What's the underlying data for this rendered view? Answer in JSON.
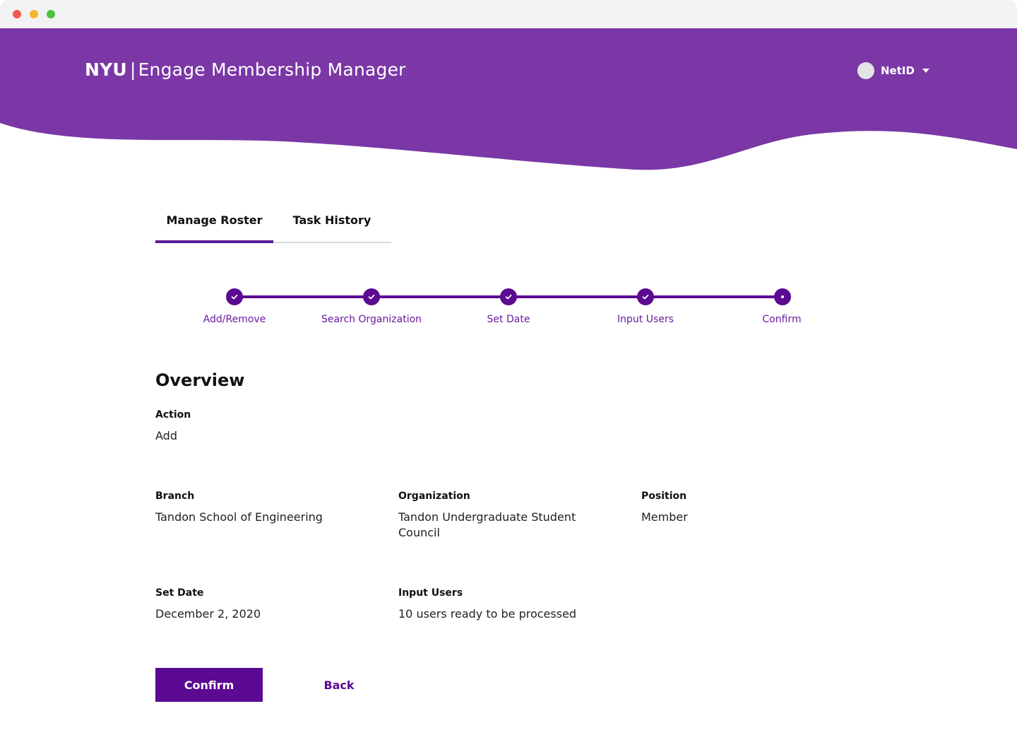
{
  "colors": {
    "primary": "#7a37a5",
    "accent": "#5b0a91",
    "step_text": "#6b1aa1",
    "window_bar": "#f2f2f4"
  },
  "header": {
    "brand": "NYU",
    "separator": "|",
    "app_title": "Engage Membership Manager",
    "user": {
      "label": "NetID",
      "avatar_icon": "avatar",
      "dropdown_icon": "caret-down-icon"
    }
  },
  "tabs": [
    {
      "label": "Manage Roster",
      "active": true
    },
    {
      "label": "Task History",
      "active": false
    }
  ],
  "stepper": {
    "steps": [
      {
        "label": "Add/Remove",
        "state": "complete"
      },
      {
        "label": "Search Organization",
        "state": "complete"
      },
      {
        "label": "Set Date",
        "state": "complete"
      },
      {
        "label": "Input Users",
        "state": "complete"
      },
      {
        "label": "Confirm",
        "state": "current"
      }
    ]
  },
  "overview": {
    "title": "Overview",
    "action": {
      "label": "Action",
      "value": "Add"
    },
    "branch": {
      "label": "Branch",
      "value": "Tandon School of Engineering"
    },
    "organization": {
      "label": "Organization",
      "value_line1": "Tandon Undergraduate Student",
      "value_line2": "Council"
    },
    "position": {
      "label": "Position",
      "value": "Member"
    },
    "set_date": {
      "label": "Set Date",
      "value": "December 2, 2020"
    },
    "input_users": {
      "label": "Input Users",
      "value": "10 users ready to be processed"
    }
  },
  "actions": {
    "confirm_label": "Confirm",
    "back_label": "Back"
  }
}
